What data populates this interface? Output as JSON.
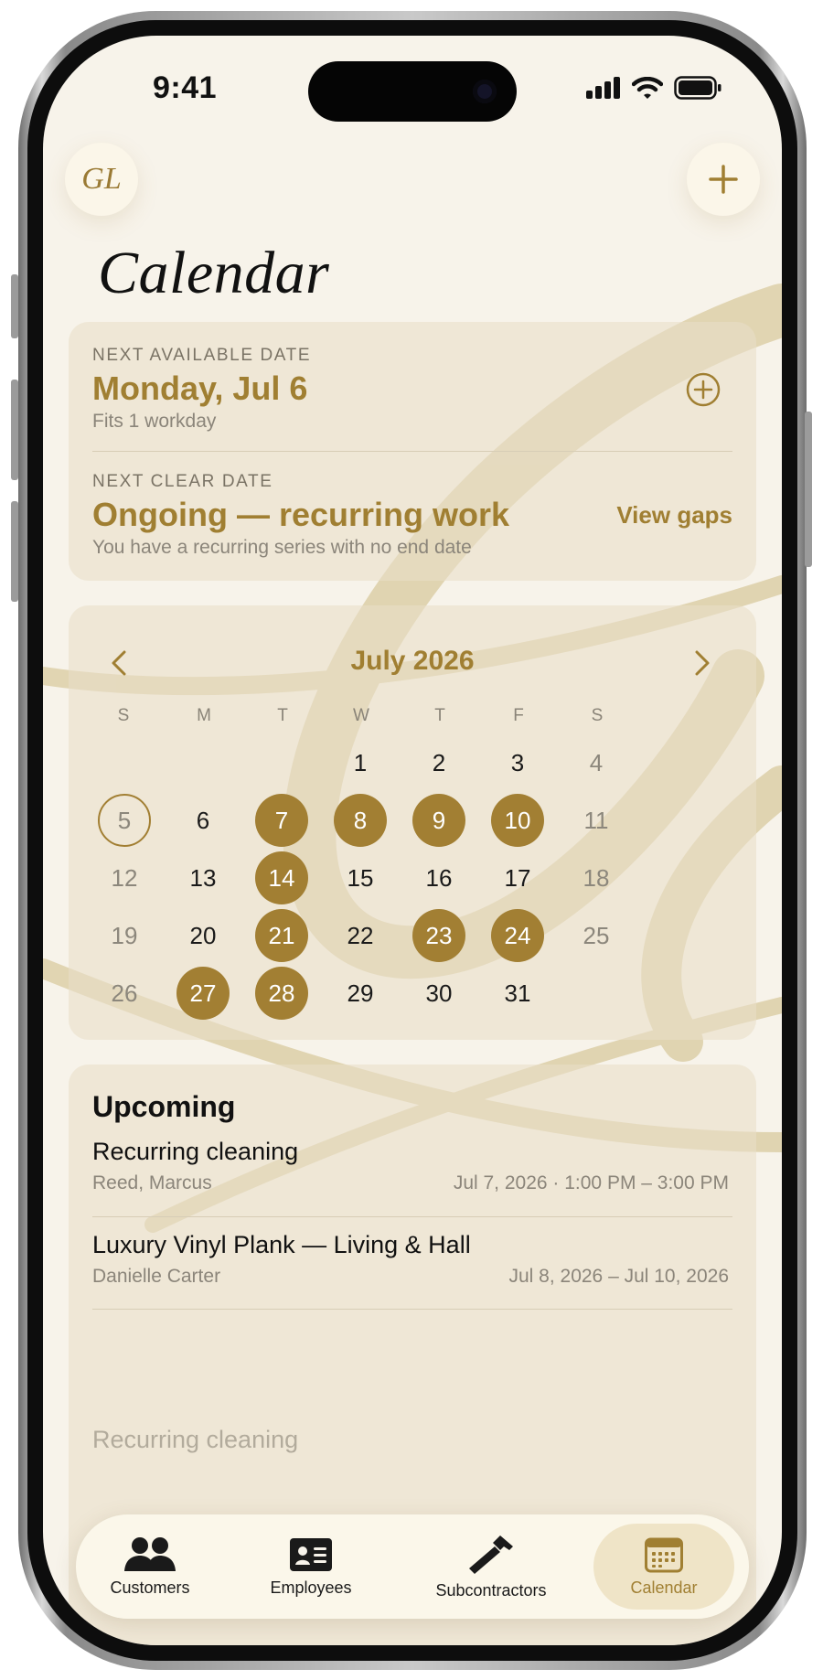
{
  "status_bar": {
    "time": "9:41"
  },
  "header": {
    "logo": "GL",
    "add_icon": "plus-icon",
    "title": "Calendar"
  },
  "availability": {
    "next_available_label": "NEXT AVAILABLE DATE",
    "next_available_date": "Monday, Jul 6",
    "next_available_detail": "Fits 1 workday",
    "next_clear_label": "NEXT CLEAR DATE",
    "next_clear_value": "Ongoing — recurring work",
    "next_clear_detail": "You have a recurring series with no end date",
    "view_gaps_label": "View gaps"
  },
  "calendar": {
    "month_label": "July 2026",
    "weekdays": [
      "S",
      "M",
      "T",
      "W",
      "T",
      "F",
      "S"
    ],
    "weeks": [
      [
        null,
        null,
        null,
        1,
        2,
        3,
        4
      ],
      [
        5,
        6,
        7,
        8,
        9,
        10,
        11
      ],
      [
        12,
        13,
        14,
        15,
        16,
        17,
        18
      ],
      [
        19,
        20,
        21,
        22,
        23,
        24,
        25
      ],
      [
        26,
        27,
        28,
        29,
        30,
        31,
        null
      ]
    ],
    "selected_day": 5,
    "booked_days": [
      7,
      8,
      9,
      10,
      14,
      21,
      23,
      24,
      27,
      28
    ],
    "accent_color": "#a27f33"
  },
  "upcoming": {
    "heading": "Upcoming",
    "items": [
      {
        "title": "Recurring cleaning",
        "client": "Reed, Marcus",
        "when": "Jul 7, 2026 · 1:00 PM – 3:00 PM"
      },
      {
        "title": "Luxury Vinyl Plank — Living & Hall",
        "client": "Danielle Carter",
        "when": "Jul 8, 2026 – Jul 10, 2026"
      },
      {
        "title": "Recurring cleaning",
        "client": "",
        "when": ""
      }
    ]
  },
  "tabbar": {
    "tabs": [
      {
        "label": "Customers",
        "icon": "people-icon"
      },
      {
        "label": "Employees",
        "icon": "id-card-icon"
      },
      {
        "label": "Subcontractors",
        "icon": "hammer-icon"
      },
      {
        "label": "Calendar",
        "icon": "calendar-icon",
        "active": true
      }
    ]
  }
}
